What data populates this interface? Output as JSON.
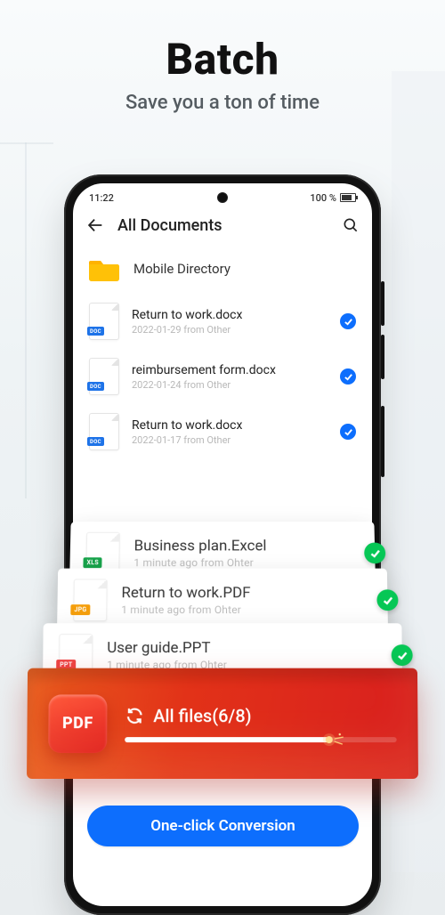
{
  "hero": {
    "title": "Batch",
    "subtitle": "Save you a ton of time"
  },
  "status": {
    "time": "11:22",
    "battery_pct": "100 %"
  },
  "appbar": {
    "title": "All Documents"
  },
  "folder": {
    "label": "Mobile Directory"
  },
  "files": [
    {
      "badge": "DOC",
      "badge_class": "doc",
      "name": "Return to work.docx",
      "meta": "2022-01-29 from Other",
      "checked": true
    },
    {
      "badge": "DOC",
      "badge_class": "doc",
      "name": "reimbursement form.docx",
      "meta": "2022-01-24 from Other",
      "checked": true
    },
    {
      "badge": "DOC",
      "badge_class": "doc",
      "name": "Return to work.docx",
      "meta": "2022-01-17 from Other",
      "checked": true
    }
  ],
  "float_cards": [
    {
      "badge": "XLS",
      "badge_class": "xls",
      "name": "Business plan.Excel",
      "meta": "1 minute ago from Ohter"
    },
    {
      "badge": "JPG",
      "badge_class": "jpg",
      "name": "Return to work.PDF",
      "meta": "1 minute ago from Ohter"
    },
    {
      "badge": "PPT",
      "badge_class": "ppt",
      "name": "User guide.PPT",
      "meta": "1 minute ago from Ohter"
    }
  ],
  "progress": {
    "chip_label": "PDF",
    "label": "All files(6/8)",
    "percent": 75
  },
  "cta": {
    "label": "One-click Conversion"
  }
}
